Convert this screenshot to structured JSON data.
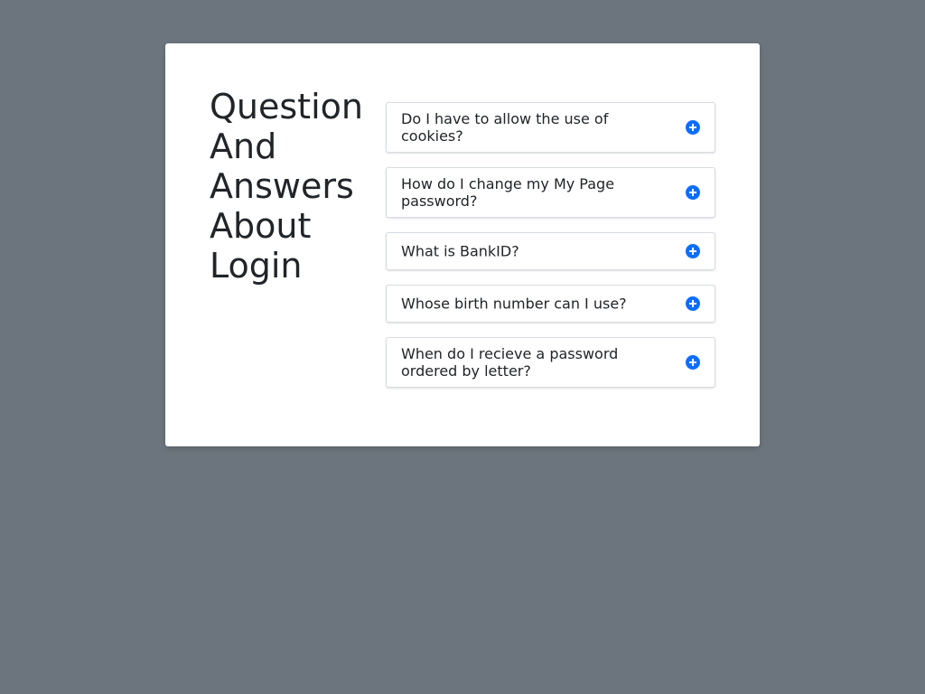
{
  "page": {
    "heading": "Question And Answers About Login"
  },
  "faq": {
    "items": [
      {
        "question": "Do I have to allow the use of cookies?",
        "icon": "plus-circle-icon"
      },
      {
        "question": "How do I change my My Page password?",
        "icon": "plus-circle-icon"
      },
      {
        "question": "What is BankID?",
        "icon": "plus-circle-icon"
      },
      {
        "question": "Whose birth number can I use?",
        "icon": "plus-circle-icon"
      },
      {
        "question": "When do I recieve a password ordered by letter?",
        "icon": "plus-circle-icon"
      }
    ]
  },
  "colors": {
    "background": "#6c757d",
    "card": "#ffffff",
    "accent": "#0d6efd",
    "text": "#212529"
  }
}
